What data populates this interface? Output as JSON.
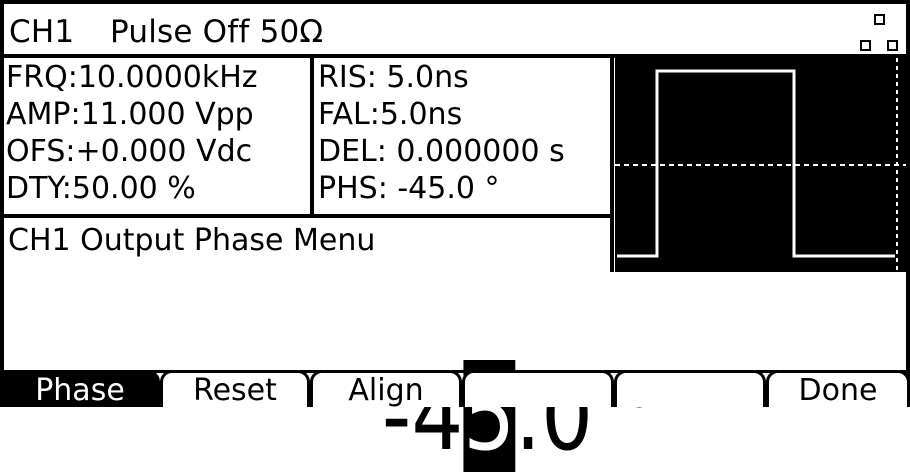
{
  "title_bar": {
    "channel": "CH1",
    "mode": "Pulse Off 50Ω",
    "icon": "multi-channel-squares-icon"
  },
  "params": {
    "frq": "FRQ:10.0000kHz",
    "amp": "AMP:11.000 Vpp",
    "ofs": "OFS:+0.000 Vdc",
    "dty": "DTY:50.00 %",
    "ris": "RIS: 5.0ns",
    "fal": "FAL:5.0ns",
    "del": "DEL: 0.000000 s",
    "phs": "PHS: -45.0 °"
  },
  "menu": {
    "title": "CH1 Output Phase Menu"
  },
  "value": {
    "prefix": "-4",
    "cursor_digit": "5",
    "suffix": ".0 °"
  },
  "softkeys": [
    {
      "label": "Phase",
      "active": true
    },
    {
      "label": "Reset",
      "active": false
    },
    {
      "label": "Align",
      "active": false
    },
    {
      "label": "",
      "active": false
    },
    {
      "label": "",
      "active": false
    },
    {
      "label": "Done",
      "active": false
    }
  ],
  "colors": {
    "background": "#ffffff",
    "foreground": "#000000"
  }
}
